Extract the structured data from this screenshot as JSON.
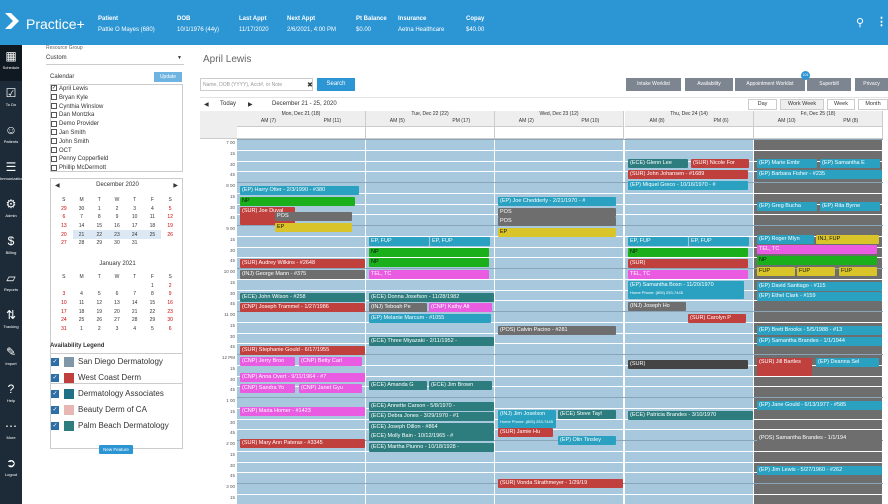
{
  "app": {
    "brand": "Practice+"
  },
  "patient": [
    {
      "label": "Patient",
      "value": "Pattie O Mayes (680)"
    },
    {
      "label": "DOB",
      "value": "10/1/1976 (44y)"
    },
    {
      "label": "Last Appt",
      "value": "11/17/2020"
    },
    {
      "label": "Next Appt",
      "value": "2/6/2021, 4:00 PM"
    },
    {
      "label": "Pt Balance",
      "value": "$0.00"
    },
    {
      "label": "Insurance",
      "value": "Aetna Healthcare"
    },
    {
      "label": "Copay",
      "value": "$40.00"
    }
  ],
  "nav": [
    "Schedule",
    "To Do",
    "Patients",
    "Immunization",
    "Admin",
    "Billing",
    "Reports",
    "Tracking",
    "Import",
    "Help",
    "More",
    "Logout"
  ],
  "left": {
    "resource_group_label": "Resource Group",
    "resource_group": "Custom",
    "calendar_label": "Calendar",
    "update_btn": "Update",
    "calendars": [
      {
        "name": "April Lewis",
        "checked": true
      },
      {
        "name": "Bryan Kyle",
        "checked": false
      },
      {
        "name": "Cynthia Winslow",
        "checked": false
      },
      {
        "name": "Dan Montzka",
        "checked": false
      },
      {
        "name": "Demo Provider",
        "checked": false
      },
      {
        "name": "Jan Smith",
        "checked": false
      },
      {
        "name": "John Smith",
        "checked": false
      },
      {
        "name": "OCT",
        "checked": false
      },
      {
        "name": "Penny Copperfield",
        "checked": false
      },
      {
        "name": "Phillip McDermott",
        "checked": false
      }
    ],
    "month1": "December 2020",
    "month2": "January 2021",
    "weekdays": [
      "S",
      "M",
      "T",
      "W",
      "T",
      "F",
      "S"
    ],
    "m1": [
      [
        "29",
        "30",
        "1",
        "2",
        "3",
        "4",
        "5"
      ],
      [
        "6",
        "7",
        "8",
        "9",
        "10",
        "11",
        "12"
      ],
      [
        "13",
        "14",
        "15",
        "16",
        "17",
        "18",
        "19"
      ],
      [
        "20",
        "21",
        "22",
        "23",
        "24",
        "25",
        "26"
      ],
      [
        "27",
        "28",
        "29",
        "30",
        "31",
        "",
        ""
      ]
    ],
    "m2": [
      [
        "",
        "",
        "",
        "",
        "",
        "1",
        "2"
      ],
      [
        "3",
        "4",
        "5",
        "6",
        "7",
        "8",
        "9"
      ],
      [
        "10",
        "11",
        "12",
        "13",
        "14",
        "15",
        "16"
      ],
      [
        "17",
        "18",
        "19",
        "20",
        "21",
        "22",
        "23"
      ],
      [
        "24",
        "25",
        "26",
        "27",
        "28",
        "29",
        "30"
      ],
      [
        "31",
        "1",
        "2",
        "3",
        "4",
        "5",
        "6"
      ]
    ],
    "legend_label": "Availability Legend",
    "legend": [
      {
        "name": "San Diego Dermatology",
        "color": "#7f97a8"
      },
      {
        "name": "West Coast Derm",
        "color": "#c0403e"
      },
      {
        "name": "Dermatology Associates",
        "color": "#1f6f86"
      },
      {
        "name": "Beauty Derm of CA",
        "color": "#e8b7b3"
      },
      {
        "name": "Palm Beach Dermatology",
        "color": "#2d7d7e"
      }
    ],
    "new_feature": "New Feature"
  },
  "main": {
    "title": "April Lewis",
    "search_placeholder": "Name, DOB (YYYY), Acct#, or Note",
    "search_btn": "Search",
    "toolbar": [
      "Intake Worklist",
      "Availability",
      "Appointment Worklist",
      "Superbill",
      "Privacy"
    ],
    "worklist_badge": "101",
    "today": "Today",
    "range": "December 21 - 25, 2020",
    "views": [
      "Day",
      "Work Week",
      "Week",
      "Month"
    ],
    "days": [
      {
        "title": "Mon, Dec 21 (18)",
        "am": "AM (7)",
        "pm": "PM (11)"
      },
      {
        "title": "Tue, Dec 22 (22)",
        "am": "AM (5)",
        "pm": "PM (17)"
      },
      {
        "title": "Wed, Dec 23 (12)",
        "am": "AM (2)",
        "pm": "PM (10)"
      },
      {
        "title": "Thu, Dec 24 (14)",
        "am": "AM (8)",
        "pm": "PM (6)"
      },
      {
        "title": "Fri, Dec 25 (18)",
        "am": "AM (10)",
        "pm": "PM (8)"
      }
    ],
    "times": [
      "7 00",
      "15",
      "30",
      "45",
      "8 00",
      "15",
      "30",
      "45",
      "9 00",
      "15",
      "30",
      "45",
      "10 00",
      "15",
      "30",
      "45",
      "11 00",
      "15",
      "30",
      "45",
      "12 PM",
      "15",
      "30",
      "45",
      "1 00",
      "15",
      "30",
      "45",
      "2 00",
      "15",
      "30",
      "45",
      "3 00",
      "15"
    ]
  },
  "appointments": [
    {
      "text": "(EP) Harry Otter - 2/3/1990 - #380",
      "color": "#2aa1c0"
    },
    {
      "text": "NP",
      "color": "#1bb01b"
    },
    {
      "text": "(SUR) Joe Duval",
      "color": "#c0403e"
    },
    {
      "text": "POS",
      "color": "#6e6e6e"
    },
    {
      "text": "EP",
      "color": "#d9c52a"
    },
    {
      "text": "(SUR) Audrey Wilkins - #2648",
      "color": "#c0403e"
    },
    {
      "text": "(INJ) George Mann - #375",
      "color": "#6e6e6e"
    },
    {
      "text": "(ECE) John Wilson - #258",
      "color": "#2d7d7e"
    },
    {
      "text": "(CNP) Joseph Trammel - 1/27/1986",
      "color": "#c0403e"
    },
    {
      "text": "(SUR) Stephanie Gould - 6/17/1955",
      "color": "#c0403e"
    },
    {
      "text": "(CNP) Jerry Broo",
      "color": "#e95be0"
    },
    {
      "text": "(CNP) Betty Carl",
      "color": "#e95be0"
    },
    {
      "text": "(CNP) Anna Overt - 9/11/1964 - #7",
      "color": "#e95be0"
    },
    {
      "text": "(CNP) Sandra Yo",
      "color": "#e95be0"
    },
    {
      "text": "(CNP) Janet Gyu",
      "color": "#e95be0"
    },
    {
      "text": "(CNP) Maria Homer - #1423",
      "color": "#e95be0"
    },
    {
      "text": "(SUR) Mary Ann Pateras - #3345",
      "color": "#c0403e"
    },
    {
      "text": "EP, FUP",
      "color": "#2aa1c0"
    },
    {
      "text": "EP, FUP",
      "color": "#2aa1c0"
    },
    {
      "text": "NP",
      "color": "#1bb01b"
    },
    {
      "text": "NP",
      "color": "#1bb01b"
    },
    {
      "text": "TEL, TC",
      "color": "#e95be0"
    },
    {
      "text": "(ECE) Donna Josefson - 11/28/1982",
      "color": "#2d7d7e"
    },
    {
      "text": "(INJ) Teboah Pe",
      "color": "#6e6e6e"
    },
    {
      "text": "(CNP) Kathy Alt",
      "color": "#e95be0"
    },
    {
      "text": "(EP) Melanie Marcum - #1055",
      "color": "#2aa1c0"
    },
    {
      "text": "(ECE) Three Miyazaki - 2/11/1952 -",
      "color": "#2d7d7e"
    },
    {
      "text": "(ECE) Amanda G",
      "color": "#2d7d7e"
    },
    {
      "text": "(ECE) Jim Brown",
      "color": "#2d7d7e"
    },
    {
      "text": "(ECE) Annette Carson - 5/8/1970 -",
      "color": "#2d7d7e"
    },
    {
      "text": "(ECE) Debra Jones - 3/29/1970 - #1",
      "color": "#2d7d7e"
    },
    {
      "text": "(ECE) Joseph Dillon - #864",
      "color": "#2d7d7e"
    },
    {
      "text": "(ECE) Molly Bain - 10/12/1965 - #",
      "color": "#2d7d7e"
    },
    {
      "text": "(ECE) Martha Piunno - 10/18/1928 -",
      "color": "#2d7d7e"
    },
    {
      "text": "(EP) Joe Chedderly - 2/21/1970 - #",
      "color": "#2aa1c0"
    },
    {
      "text": "POS",
      "color": "#6e6e6e"
    },
    {
      "text": "POS",
      "color": "#6e6e6e"
    },
    {
      "text": "EP",
      "color": "#d9c52a"
    },
    {
      "text": "(POS) Calvin Pacino - #281",
      "color": "#6e6e6e"
    },
    {
      "text": "(INJ) Jim Joselson",
      "sub": "Home Phone: (805) 253-7445",
      "color": "#2aa1c0"
    },
    {
      "text": "(ECE) Steve Tayl",
      "color": "#2d7d7e"
    },
    {
      "text": "(SUR) Jamie Hu",
      "color": "#c0403e"
    },
    {
      "text": "(EP) Olin Tinsley",
      "color": "#2aa1c0"
    },
    {
      "text": "(SUR) Vonda Strathmeyer - 1/29/19",
      "color": "#c0403e"
    },
    {
      "text": "(ECE) Glenn Lee",
      "color": "#2d7d7e"
    },
    {
      "text": "(SUR) Nicole For",
      "color": "#c0403e"
    },
    {
      "text": "(SUR) John Johansen - #1689",
      "color": "#c0403e"
    },
    {
      "text": "(EP) Miquel Greco - 10/16/1970 - #",
      "color": "#2aa1c0"
    },
    {
      "text": "EP, FUP",
      "color": "#2aa1c0"
    },
    {
      "text": "EP, FUP",
      "color": "#2aa1c0"
    },
    {
      "text": "NP",
      "color": "#1bb01b"
    },
    {
      "text": "(SUR)",
      "color": "#c0403e"
    },
    {
      "text": "TEL, TC",
      "color": "#e95be0"
    },
    {
      "text": "(EP) Samantha Bosn - 11/20/1970",
      "sub": "Home Phone: (805) 253-7445",
      "color": "#2aa1c0"
    },
    {
      "text": "(INJ) Joseph Ho",
      "color": "#6e6e6e"
    },
    {
      "text": "(SUR) Carolyn P",
      "color": "#c0403e"
    },
    {
      "text": "(SUR)",
      "color": "#444444"
    },
    {
      "text": "(ECE) Patricia Brandes - 3/10/1970",
      "color": "#2d7d7e"
    },
    {
      "text": "(EP) Marie Embr",
      "color": "#2aa1c0"
    },
    {
      "text": "(EP) Samantha E",
      "color": "#2aa1c0"
    },
    {
      "text": "(EP) Barbara Fisher - #235",
      "color": "#2aa1c0"
    },
    {
      "text": "(EP) Greg Bucha",
      "color": "#2aa1c0"
    },
    {
      "text": "(EP) Rita Byrne",
      "color": "#2aa1c0"
    },
    {
      "text": "(EP) Roger Mlyn",
      "color": "#2aa1c0"
    },
    {
      "text": "INJ, FUP",
      "color": "#d9c52a"
    },
    {
      "text": "TEL, TC",
      "color": "#e95be0"
    },
    {
      "text": "NP",
      "color": "#1bb01b"
    },
    {
      "text": "FUP",
      "color": "#d9c52a"
    },
    {
      "text": "FUP",
      "color": "#d9c52a"
    },
    {
      "text": "FUP",
      "color": "#d9c52a"
    },
    {
      "text": "(EP) David Santiago - #115",
      "color": "#2aa1c0"
    },
    {
      "text": "(EP) Ethel Clark - #159",
      "color": "#2aa1c0"
    },
    {
      "text": "(EP) Brett Brooks - 5/5/1988 - #13",
      "color": "#2aa1c0"
    },
    {
      "text": "(EP) Samantha Brandes - 1/1/1944",
      "color": "#2aa1c0"
    },
    {
      "text": "(SUR) Jill Bartles",
      "color": "#c0403e"
    },
    {
      "text": "(EP) Deanna Sel",
      "color": "#2aa1c0"
    },
    {
      "text": "(EP) Jane Gould - 6/13/1977 - #585",
      "color": "#2aa1c0"
    },
    {
      "text": "(POS) Samantha Brandes - 1/1/194",
      "color": "#6e6e6e"
    },
    {
      "text": "(EP) Jim Lewis - 5/27/1960 - #262",
      "color": "#2aa1c0"
    }
  ]
}
